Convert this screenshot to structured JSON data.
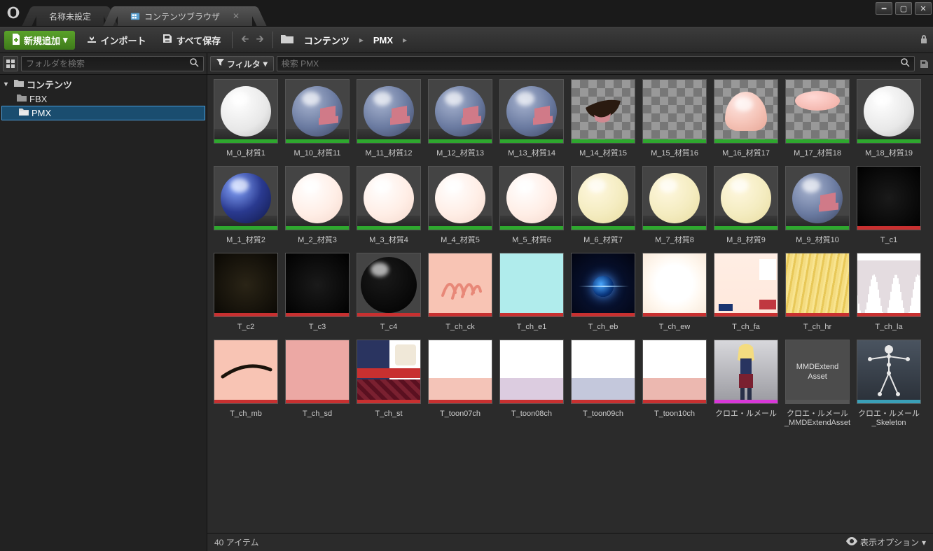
{
  "tabs": {
    "level": "名称未設定",
    "browser": "コンテンツブラウザ"
  },
  "toolbar": {
    "new": "新規追加",
    "import": "インポート",
    "saveall": "すべて保存"
  },
  "breadcrumb": {
    "root": "コンテンツ",
    "current": "PMX"
  },
  "sidebar": {
    "search_placeholder": "フォルダを検索",
    "root": "コンテンツ",
    "children": [
      "FBX",
      "PMX"
    ]
  },
  "mainbar": {
    "filter": "フィルタ",
    "search_placeholder": "検索 PMX"
  },
  "status": {
    "count": "40 アイテム",
    "viewopt": "表示オプション"
  },
  "assets": [
    {
      "name": "M_0_材質1",
      "type": "mat",
      "thumb": "sphere_white"
    },
    {
      "name": "M_10_材質11",
      "type": "mat",
      "thumb": "sphere_helmet"
    },
    {
      "name": "M_11_材質12",
      "type": "mat",
      "thumb": "sphere_helmet"
    },
    {
      "name": "M_12_材質13",
      "type": "mat",
      "thumb": "sphere_helmet"
    },
    {
      "name": "M_13_材質14",
      "type": "mat",
      "thumb": "sphere_helmet"
    },
    {
      "name": "M_14_材質15",
      "type": "mat",
      "thumb": "sphere_mouth"
    },
    {
      "name": "M_15_材質16",
      "type": "mat",
      "thumb": "sphere_checker"
    },
    {
      "name": "M_16_材質17",
      "type": "mat",
      "thumb": "sphere_pink3d"
    },
    {
      "name": "M_17_材質18",
      "type": "mat",
      "thumb": "sphere_pinkdisc"
    },
    {
      "name": "M_18_材質19",
      "type": "mat",
      "thumb": "sphere_white"
    },
    {
      "name": "M_1_材質2",
      "type": "mat",
      "thumb": "sphere_blue"
    },
    {
      "name": "M_2_材質3",
      "type": "mat",
      "thumb": "sphere_skin"
    },
    {
      "name": "M_3_材質4",
      "type": "mat",
      "thumb": "sphere_skin"
    },
    {
      "name": "M_4_材質5",
      "type": "mat",
      "thumb": "sphere_skin"
    },
    {
      "name": "M_5_材質6",
      "type": "mat",
      "thumb": "sphere_skin"
    },
    {
      "name": "M_6_材質7",
      "type": "mat",
      "thumb": "sphere_cream"
    },
    {
      "name": "M_7_材質8",
      "type": "mat",
      "thumb": "sphere_cream"
    },
    {
      "name": "M_8_材質9",
      "type": "mat",
      "thumb": "sphere_cream"
    },
    {
      "name": "M_9_材質10",
      "type": "mat",
      "thumb": "sphere_helmet"
    },
    {
      "name": "T_c1",
      "type": "tex",
      "thumb": "tex_black"
    },
    {
      "name": "T_c2",
      "type": "tex",
      "thumb": "tex_darkgrad"
    },
    {
      "name": "T_c3",
      "type": "tex",
      "thumb": "tex_black"
    },
    {
      "name": "T_c4",
      "type": "tex",
      "thumb": "tex_blacksphere"
    },
    {
      "name": "T_ch_ck",
      "type": "tex",
      "thumb": "tex_scribble"
    },
    {
      "name": "T_ch_e1",
      "type": "tex",
      "thumb": "tex_cyan"
    },
    {
      "name": "T_ch_eb",
      "type": "tex",
      "thumb": "tex_eye"
    },
    {
      "name": "T_ch_ew",
      "type": "tex",
      "thumb": "tex_whiteglow"
    },
    {
      "name": "T_ch_fa",
      "type": "tex",
      "thumb": "tex_face"
    },
    {
      "name": "T_ch_hr",
      "type": "tex",
      "thumb": "tex_hair"
    },
    {
      "name": "T_ch_la",
      "type": "tex",
      "thumb": "tex_lines"
    },
    {
      "name": "T_ch_mb",
      "type": "tex",
      "thumb": "tex_brow"
    },
    {
      "name": "T_ch_sd",
      "type": "tex",
      "thumb": "tex_pink"
    },
    {
      "name": "T_ch_st",
      "type": "tex",
      "thumb": "tex_outfit"
    },
    {
      "name": "T_toon07ch",
      "type": "tex",
      "thumb": "tex_toon1"
    },
    {
      "name": "T_toon08ch",
      "type": "tex",
      "thumb": "tex_toon2"
    },
    {
      "name": "T_toon09ch",
      "type": "tex",
      "thumb": "tex_toon3"
    },
    {
      "name": "T_toon10ch",
      "type": "tex",
      "thumb": "tex_toon4"
    },
    {
      "name": "クロエ・ルメール",
      "type": "skm",
      "thumb": "char"
    },
    {
      "name": "クロエ・ルメール_MMDExtendAsset",
      "type": "data",
      "thumb": "mmdblank"
    },
    {
      "name": "クロエ・ルメール_Skeleton",
      "type": "skel",
      "thumb": "skel"
    }
  ]
}
